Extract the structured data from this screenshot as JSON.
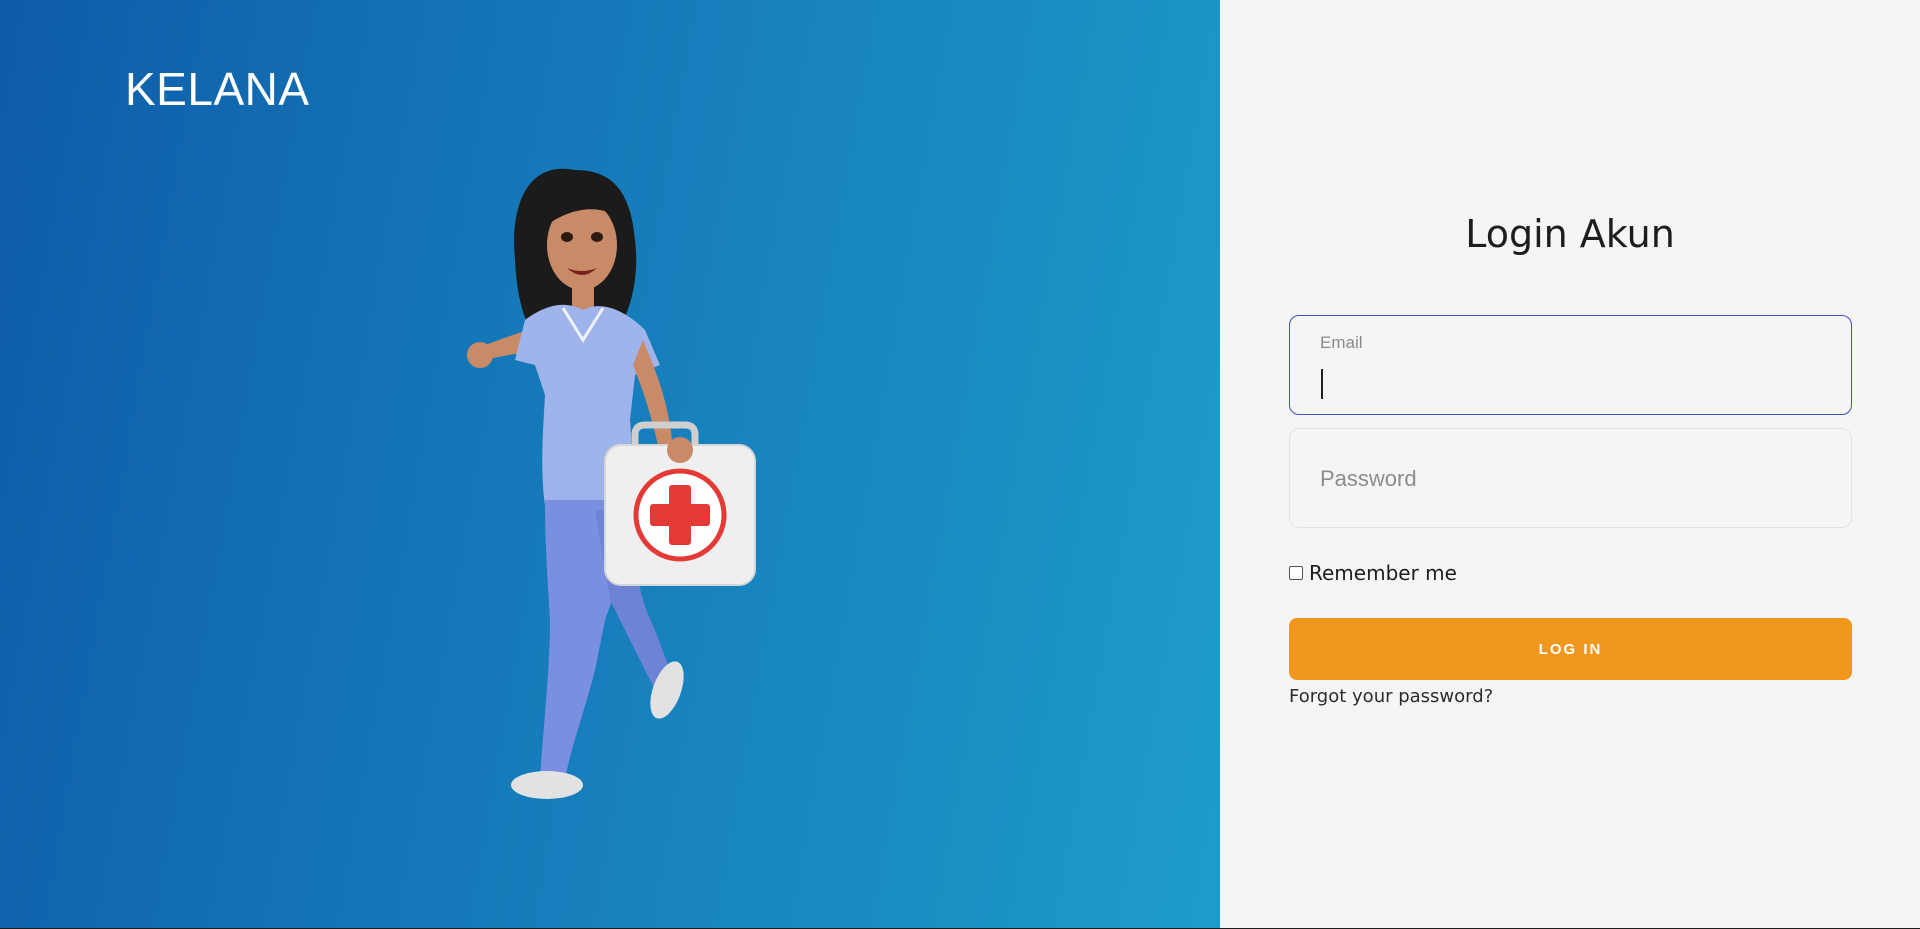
{
  "brand": {
    "name": "KELANA"
  },
  "illustration": {
    "name": "nurse-with-first-aid-kit"
  },
  "login": {
    "title": "Login Akun",
    "email_label": "Email",
    "email_value": "",
    "password_placeholder": "Password",
    "remember_label": "Remember me",
    "remember_checked": false,
    "submit_label": "LOG IN",
    "forgot_label": "Forgot your password?"
  },
  "colors": {
    "gradient_start": "#0e5ca8",
    "gradient_end": "#1d9ccb",
    "panel_bg": "#f5f5f5",
    "button": "#f0971d",
    "focus_border": "#3d4fc4"
  }
}
